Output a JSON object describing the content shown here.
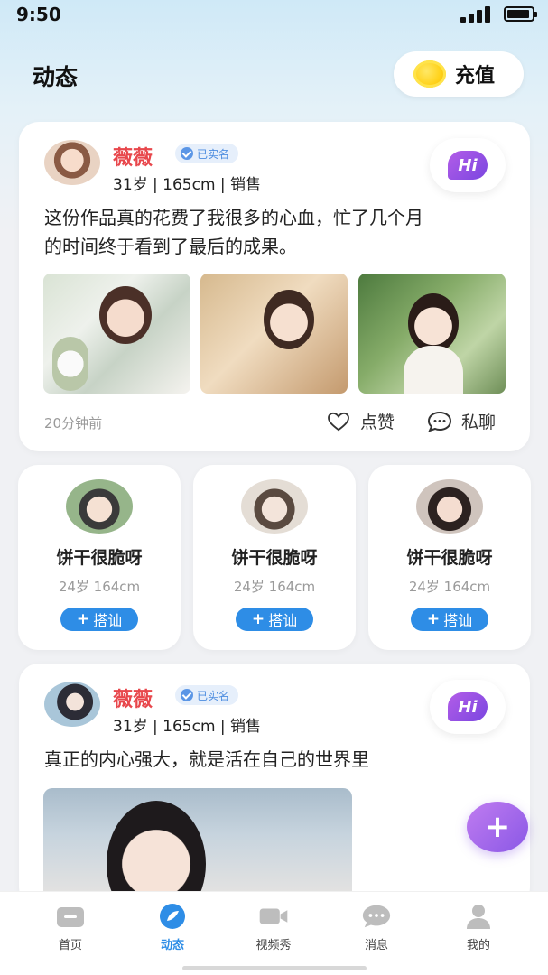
{
  "status_bar": {
    "time": "9:50"
  },
  "header": {
    "title": "动态",
    "recharge_label": "充值"
  },
  "posts": [
    {
      "nickname": "薇薇",
      "verified": "已实名",
      "meta": "31岁 | 165cm | 销售",
      "hi": "Hi",
      "text_line1": "这份作品真的花费了我很多的心血，忙了几个月",
      "text_line2": "的时间终于看到了最后的成果。",
      "time": "20分钟前",
      "like_label": "点赞",
      "chat_label": "私聊"
    },
    {
      "nickname": "薇薇",
      "verified": "已实名",
      "meta": "31岁 | 165cm | 销售",
      "hi": "Hi",
      "text_line1": "真正的内心强大，就是活在自己的世界里"
    }
  ],
  "recommend_users": [
    {
      "name": "饼干很脆呀",
      "meta": "24岁 164cm",
      "button": "搭讪"
    },
    {
      "name": "饼干很脆呀",
      "meta": "24岁 164cm",
      "button": "搭讪"
    },
    {
      "name": "饼干很脆呀",
      "meta": "24岁 164cm",
      "button": "搭讪"
    }
  ],
  "fab": {
    "icon": "+"
  },
  "tabs": [
    {
      "label": "首页",
      "icon": "home-icon"
    },
    {
      "label": "动态",
      "icon": "moments-icon"
    },
    {
      "label": "视频秀",
      "icon": "video-icon"
    },
    {
      "label": "消息",
      "icon": "message-icon"
    },
    {
      "label": "我的",
      "icon": "profile-icon"
    }
  ],
  "colors": {
    "accent": "#2e8de6",
    "nickname": "#e8474c",
    "hi_bubble": "#8a58e6"
  }
}
